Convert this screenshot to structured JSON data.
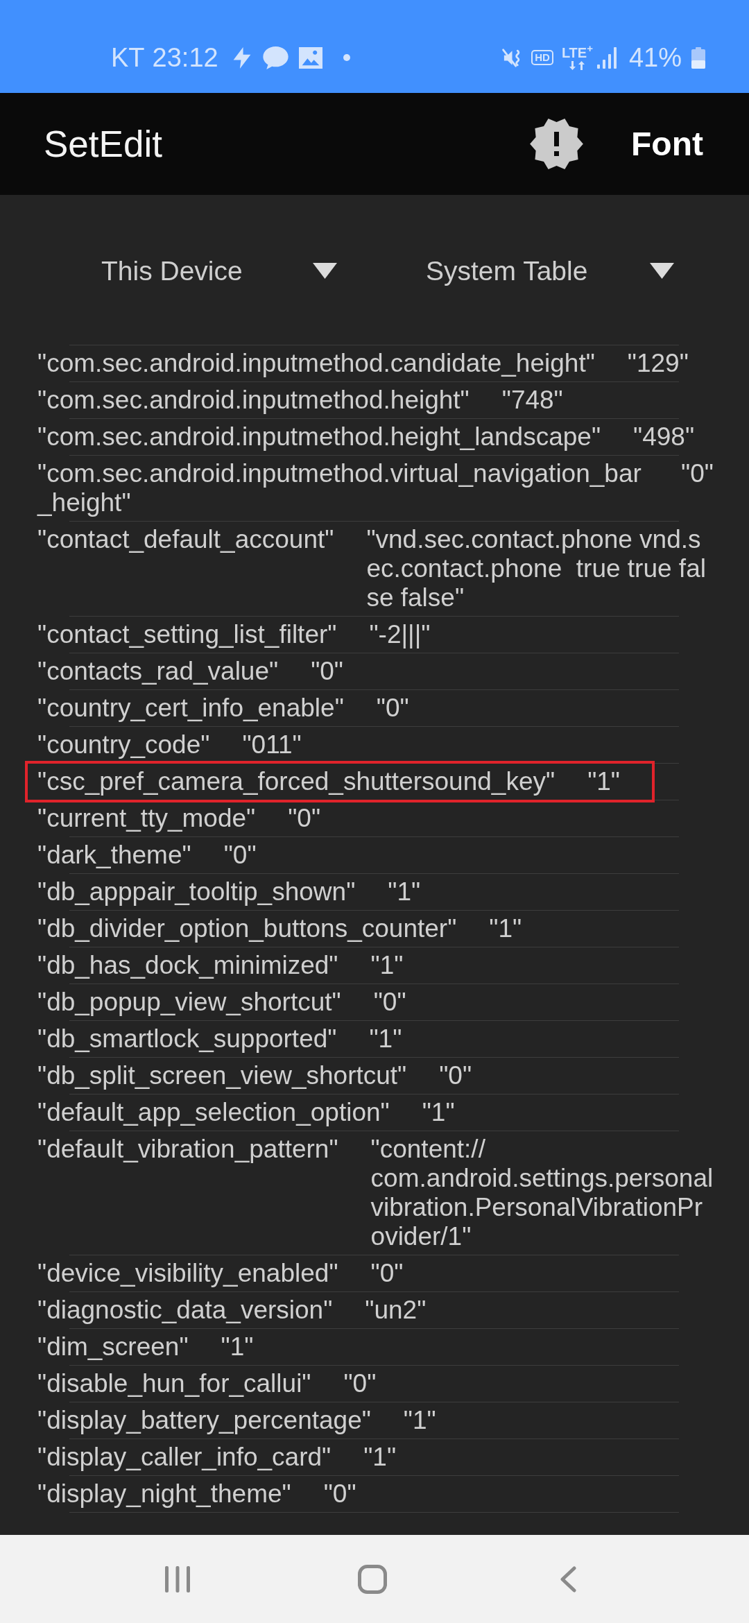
{
  "status_bar": {
    "carrier": "KT",
    "time": "23:12",
    "hd_label": "HD",
    "network": "LTE$^{+}$",
    "battery": "41%"
  },
  "app_bar": {
    "title": "SetEdit",
    "action": "Font"
  },
  "spinners": [
    {
      "label": "This Device"
    },
    {
      "label": "System Table"
    }
  ],
  "settings": [
    {
      "key": "\"com.sec.android.inputmethod.candidate_height\"",
      "value": "\"129\"",
      "highlighted": false
    },
    {
      "key": "\"com.sec.android.inputmethod.height\"",
      "value": "\"748\"",
      "highlighted": false
    },
    {
      "key": "\"com.sec.android.inputmethod.height_landscape\"",
      "value": "\"498\"",
      "highlighted": false
    },
    {
      "key": "\"com.sec.android.inputmethod.virtual_navigation_bar_height\"",
      "value": "\"0\"",
      "highlighted": false
    },
    {
      "key": "\"contact_default_account\"",
      "value": "\"vnd.sec.contact.phone vnd.sec.contact.phone  true true false false\"",
      "highlighted": false
    },
    {
      "key": "\"contact_setting_list_filter\"",
      "value": "\"-2|||\"",
      "highlighted": false
    },
    {
      "key": "\"contacts_rad_value\"",
      "value": "\"0\"",
      "highlighted": false
    },
    {
      "key": "\"country_cert_info_enable\"",
      "value": "\"0\"",
      "highlighted": false
    },
    {
      "key": "\"country_code\"",
      "value": "\"011\"",
      "highlighted": false
    },
    {
      "key": "\"csc_pref_camera_forced_shuttersound_key\"",
      "value": "\"1\"",
      "highlighted": true
    },
    {
      "key": "\"current_tty_mode\"",
      "value": "\"0\"",
      "highlighted": false
    },
    {
      "key": "\"dark_theme\"",
      "value": "\"0\"",
      "highlighted": false
    },
    {
      "key": "\"db_apppair_tooltip_shown\"",
      "value": "\"1\"",
      "highlighted": false
    },
    {
      "key": "\"db_divider_option_buttons_counter\"",
      "value": "\"1\"",
      "highlighted": false
    },
    {
      "key": "\"db_has_dock_minimized\"",
      "value": "\"1\"",
      "highlighted": false
    },
    {
      "key": "\"db_popup_view_shortcut\"",
      "value": "\"0\"",
      "highlighted": false
    },
    {
      "key": "\"db_smartlock_supported\"",
      "value": "\"1\"",
      "highlighted": false
    },
    {
      "key": "\"db_split_screen_view_shortcut\"",
      "value": "\"0\"",
      "highlighted": false
    },
    {
      "key": "\"default_app_selection_option\"",
      "value": "\"1\"",
      "highlighted": false
    },
    {
      "key": "\"default_vibration_pattern\"",
      "value": "\"content://com.android.settings.personalvibration.PersonalVibrationProvider/1\"",
      "highlighted": false
    },
    {
      "key": "\"device_visibility_enabled\"",
      "value": "\"0\"",
      "highlighted": false
    },
    {
      "key": "\"diagnostic_data_version\"",
      "value": "\"un2\"",
      "highlighted": false
    },
    {
      "key": "\"dim_screen\"",
      "value": "\"1\"",
      "highlighted": false
    },
    {
      "key": "\"disable_hun_for_callui\"",
      "value": "\"0\"",
      "highlighted": false
    },
    {
      "key": "\"display_battery_percentage\"",
      "value": "\"1\"",
      "highlighted": false
    },
    {
      "key": "\"display_caller_info_card\"",
      "value": "\"1\"",
      "highlighted": false
    },
    {
      "key": "\"display_night_theme\"",
      "value": "\"0\"",
      "highlighted": false
    }
  ]
}
